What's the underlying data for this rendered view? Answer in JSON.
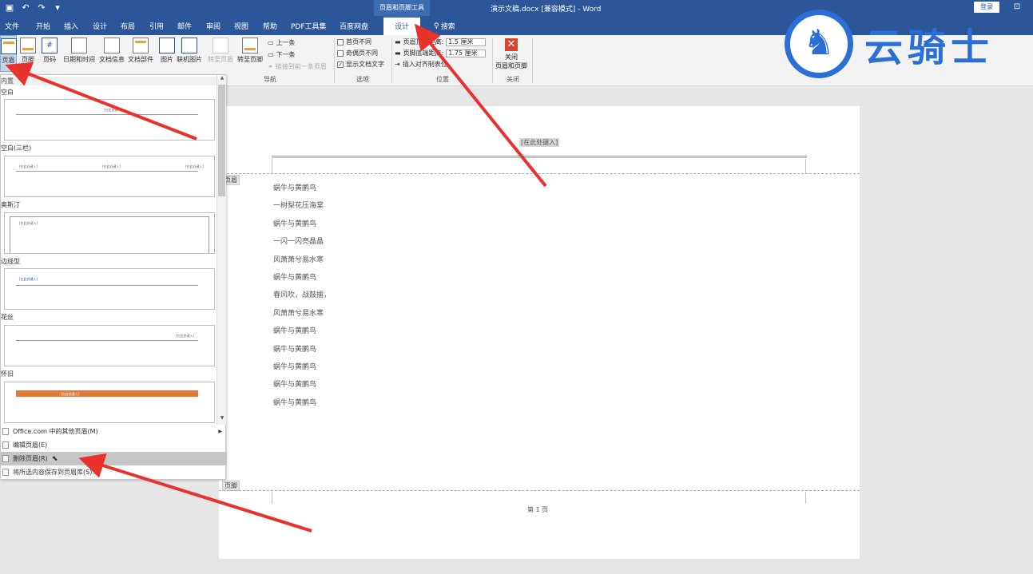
{
  "titlebar": {
    "contextual_tools": "页眉和页脚工具",
    "document_title": "演示文稿.docx [兼容模式] - Word",
    "login": "登录",
    "qat_icons": [
      "save-icon",
      "undo-icon",
      "redo-icon",
      "customize-icon"
    ]
  },
  "tabs": [
    "文件",
    "开始",
    "插入",
    "设计",
    "布局",
    "引用",
    "邮件",
    "审阅",
    "视图",
    "帮助",
    "PDF工具集",
    "百度网盘",
    "设计"
  ],
  "search": {
    "label": "搜索"
  },
  "ribbon": {
    "header": "页眉",
    "footer": "页脚",
    "page_number": "页码",
    "datetime": "日期和时间",
    "docinfo": "文档信息",
    "quickparts": "文档部件",
    "picture": "图片",
    "online_picture": "联机图片",
    "goto_header": "转至页眉",
    "goto_footer": "转至页脚",
    "prev": "上一条",
    "next": "下一条",
    "link_prev": "链接到前一条页眉",
    "first_page_diff": "首页不同",
    "odd_even_diff": "奇偶页不同",
    "show_doc_text": "显示文档文字",
    "header_top": "页眉顶端距离:",
    "header_top_value": "1.5 厘米",
    "footer_bottom": "页脚底端距离:",
    "footer_bottom_value": "1.75 厘米",
    "insert_align_tab": "插入对齐制表位",
    "close_label_1": "关闭",
    "close_label_2": "页眉和页脚",
    "groups": {
      "nav": "导航",
      "options": "选项",
      "position": "位置",
      "close": "关闭"
    }
  },
  "logo": {
    "text": "云骑士"
  },
  "gallery": {
    "section": "内置",
    "items": [
      "空白",
      "空白(三栏)",
      "奥斯汀",
      "边线型",
      "花丝",
      "怀旧"
    ],
    "placeholder": "[在此处键入]"
  },
  "menu": {
    "more_office": "Office.com 中的其他页眉(M)",
    "edit_header": "编辑页眉(E)",
    "remove_header": "删除页眉(R)",
    "save_selection": "将所选内容保存到页眉库(S)..."
  },
  "document": {
    "header_placeholder": "[在此处键入]",
    "header_tag": "页眉",
    "footer_tag": "页脚",
    "page_number": "第 1 页",
    "lines": [
      "蜗牛与黄鹂鸟",
      "一树梨花压海棠",
      "蜗牛与黄鹂鸟",
      "一闪一闪亮晶晶",
      "风萧萧兮易水寒",
      "蜗牛与黄鹂鸟",
      "春风吹，战鼓擂，",
      "风萧萧兮易水寒",
      "蜗牛与黄鹂鸟",
      "蜗牛与黄鹂鸟",
      "蜗牛与黄鹂鸟",
      "蜗牛与黄鹂鸟",
      "蜗牛与黄鹂鸟"
    ]
  },
  "colors": {
    "title_blue": "#2b579a",
    "arrow_red": "#e8322b",
    "logo_blue": "#2b6fd6"
  }
}
